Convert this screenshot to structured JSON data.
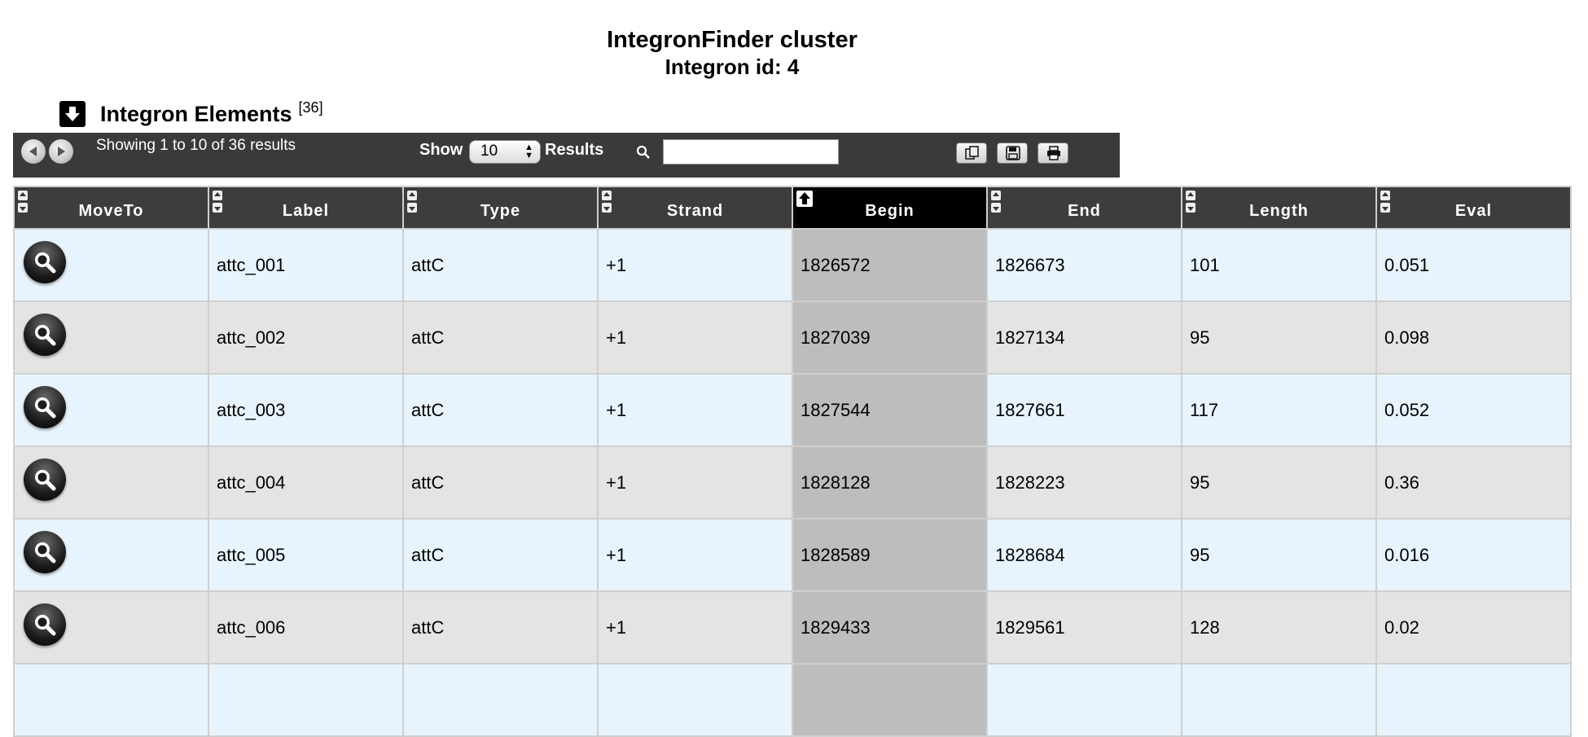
{
  "page": {
    "title": "IntegronFinder cluster",
    "subtitle": "Integron id: 4"
  },
  "section": {
    "title": "Integron Elements",
    "count": "[36]",
    "toggle_icon": "arrow-down-icon"
  },
  "toolbar": {
    "showing": "Showing 1 to 10 of 36 results",
    "show_label": "Show",
    "page_size": "10",
    "results_label": "Results",
    "search_value": "",
    "icons": [
      "copy-icon",
      "save-icon",
      "print-icon"
    ]
  },
  "table": {
    "columns": [
      "MoveTo",
      "Label",
      "Type",
      "Strand",
      "Begin",
      "End",
      "Length",
      "Eval"
    ],
    "sorted_column": "Begin",
    "rows": [
      {
        "label": "attc_001",
        "type": "attC",
        "strand": "+1",
        "begin": "1826572",
        "end": "1826673",
        "length": "101",
        "eval": "0.051"
      },
      {
        "label": "attc_002",
        "type": "attC",
        "strand": "+1",
        "begin": "1827039",
        "end": "1827134",
        "length": "95",
        "eval": "0.098"
      },
      {
        "label": "attc_003",
        "type": "attC",
        "strand": "+1",
        "begin": "1827544",
        "end": "1827661",
        "length": "117",
        "eval": "0.052"
      },
      {
        "label": "attc_004",
        "type": "attC",
        "strand": "+1",
        "begin": "1828128",
        "end": "1828223",
        "length": "95",
        "eval": "0.36"
      },
      {
        "label": "attc_005",
        "type": "attC",
        "strand": "+1",
        "begin": "1828589",
        "end": "1828684",
        "length": "95",
        "eval": "0.016"
      },
      {
        "label": "attc_006",
        "type": "attC",
        "strand": "+1",
        "begin": "1829433",
        "end": "1829561",
        "length": "128",
        "eval": "0.02"
      }
    ]
  }
}
